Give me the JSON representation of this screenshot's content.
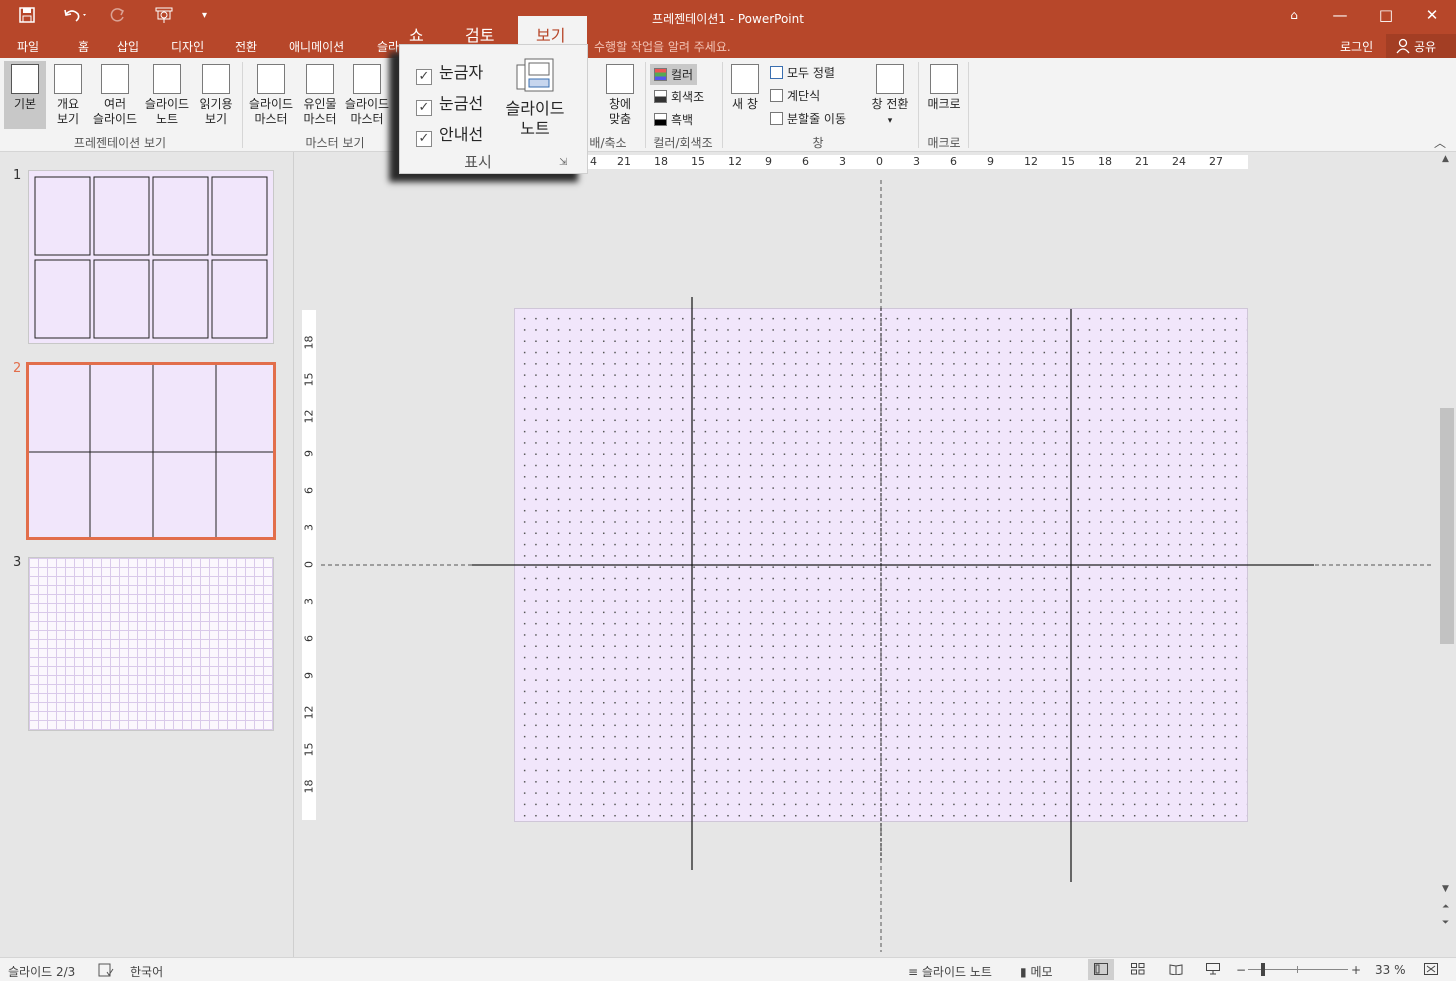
{
  "app": {
    "title": "프레젠테이션1 - PowerPoint"
  },
  "qat": {
    "save_icon": "save-icon",
    "undo_icon": "undo-icon",
    "redo_icon": "redo-icon",
    "present_icon": "present-from-start-icon",
    "customize_icon": "chevron-down-icon"
  },
  "window_buttons": {
    "ribbon_display": "⌂",
    "minimize": "—",
    "maximize": "□",
    "close": "✕"
  },
  "tabs": [
    {
      "label": "파일"
    },
    {
      "label": "홈"
    },
    {
      "label": "삽입"
    },
    {
      "label": "디자인"
    },
    {
      "label": "전환"
    },
    {
      "label": "애니메이션"
    },
    {
      "label": "슬라"
    }
  ],
  "tell_me": "수행할 작업을 알려 주세요.",
  "account": {
    "signin": "로그인",
    "share": "공유"
  },
  "popup": {
    "tab_slideshow": "쇼",
    "tab_review": "검토",
    "tab_view": "보기",
    "ruler_label": "눈금자",
    "gridlines_label": "눈금선",
    "guides_label": "안내선",
    "notes_label_1": "슬라이드",
    "notes_label_2": "노트",
    "group_label": "표시"
  },
  "ribbon": {
    "pres_views": {
      "normal": "기본",
      "outline_1": "개요",
      "outline_2": "보기",
      "sorter_1": "여러",
      "sorter_2": "슬라이드",
      "notes_1": "슬라이드",
      "notes_2": "노트",
      "reading_1": "읽기용",
      "reading_2": "보기",
      "group_label": "프레젠테이션 보기"
    },
    "master_views": {
      "slide_master_1": "슬라이드",
      "slide_master_2": "마스터",
      "handout_master_1": "유인물",
      "handout_master_2": "마스터",
      "notes_master_1": "슬라이드",
      "notes_master_2": "마스터",
      "group_label": "마스터 보기"
    },
    "zoom": {
      "fit_1": "창에",
      "fit_2": "맞춤",
      "group_label": "배/축소"
    },
    "color": {
      "color": "컬러",
      "grayscale": "회색조",
      "bw": "흑백",
      "group_label": "컬러/회색조"
    },
    "window": {
      "new_window": "새 창",
      "arrange_all": "모두 정렬",
      "cascade": "계단식",
      "move_split": "분할줄 이동",
      "switch_1": "창 전환",
      "group_label": "창"
    },
    "macros": {
      "macro": "매크로",
      "group_label": "매크로"
    }
  },
  "slides": [
    {
      "number": "1"
    },
    {
      "number": "2"
    },
    {
      "number": "3"
    }
  ],
  "hruler_ticks": [
    "4",
    "21",
    "18",
    "15",
    "12",
    "9",
    "6",
    "3",
    "0",
    "3",
    "6",
    "9",
    "12",
    "15",
    "18",
    "21",
    "24",
    "27"
  ],
  "vruler_ticks": [
    "18",
    "15",
    "12",
    "9",
    "6",
    "3",
    "0",
    "3",
    "6",
    "9",
    "12",
    "15",
    "18"
  ],
  "status": {
    "slide_info": "슬라이드 2/3",
    "language": "한국어",
    "notes": "슬라이드 노트",
    "comments": "메모",
    "zoom_level": "33 %"
  },
  "colors": {
    "accent": "#b7472a",
    "slide_bg": "#f1e6fb",
    "selected_border": "#e26e4b"
  }
}
